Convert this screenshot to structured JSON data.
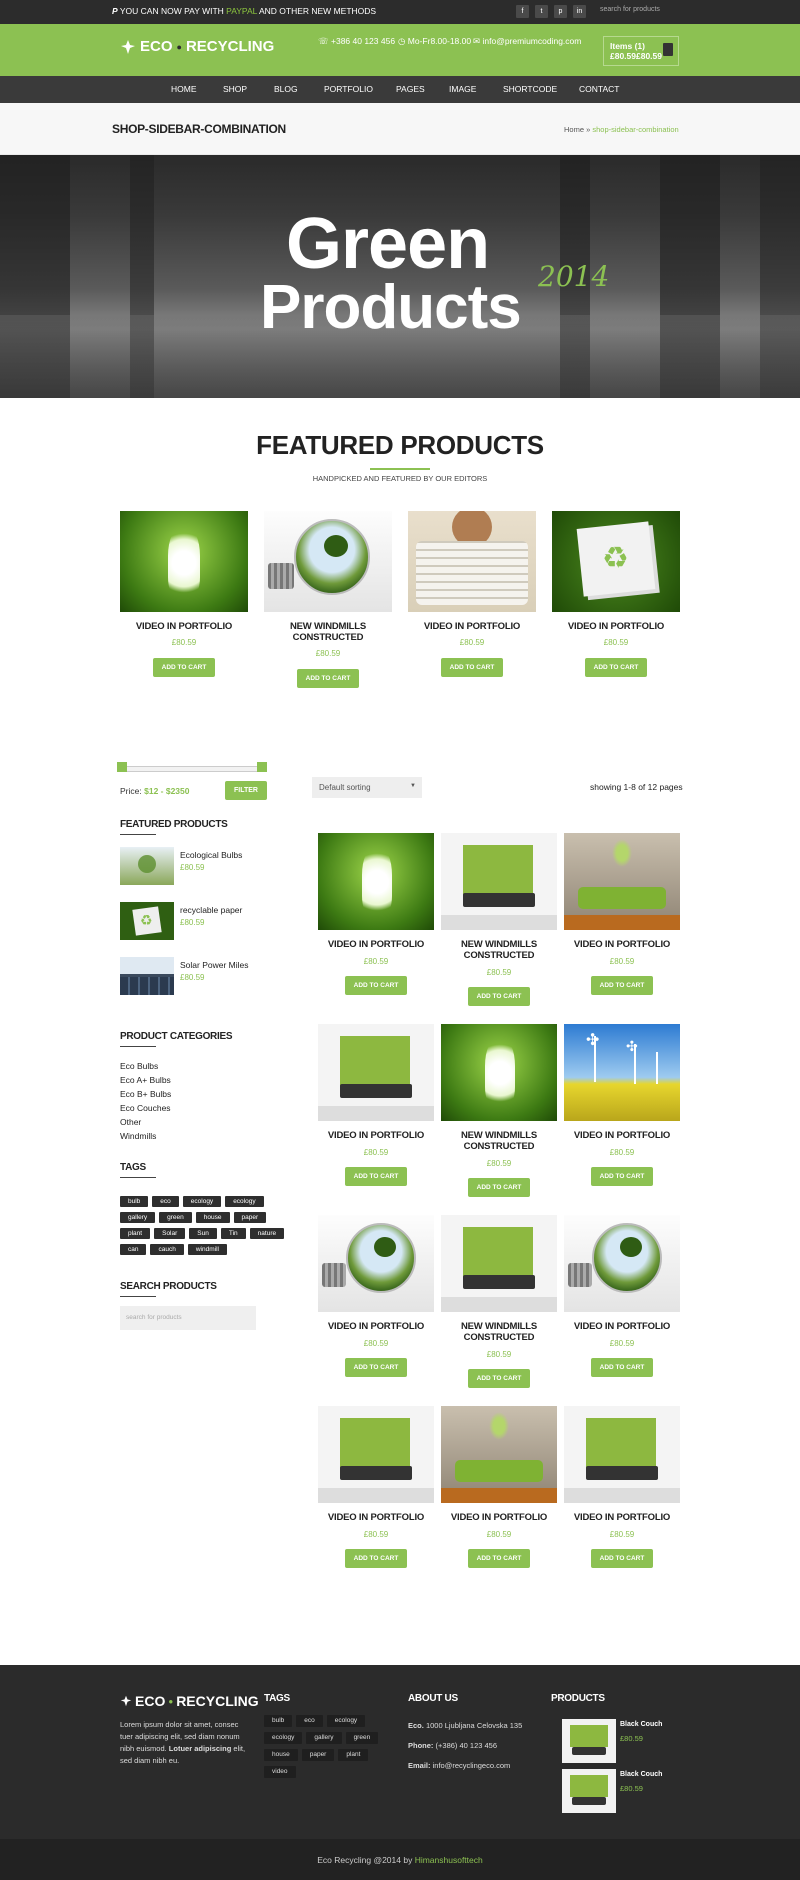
{
  "topbar": {
    "msg_prefix": "YOU CAN NOW PAY WITH",
    "msg_highlight": "PAYPAL",
    "msg_suffix": "AND OTHER NEW METHODS",
    "social": [
      "f",
      "t",
      "p",
      "in"
    ],
    "search_placeholder": "search for products"
  },
  "header": {
    "logo_a": "ECO",
    "logo_b": "RECYCLING",
    "phone": "+386 40 123 456",
    "hours": "Mo-Fr8.00-18.00",
    "email": "info@premiumcoding.com",
    "cart_items": "Items (1)",
    "cart_total": "£80.59£80.59"
  },
  "nav": [
    "HOME",
    "SHOP",
    "BLOG",
    "PORTFOLIO",
    "PAGES",
    "IMAGE",
    "SHORTCODE",
    "CONTACT"
  ],
  "breadcrumb": {
    "title": "SHOP-SIDEBAR-COMBINATION",
    "home": "Home",
    "sep": "»",
    "current": "shop-sidebar-combination"
  },
  "hero": {
    "line1": "Green",
    "line2": "Products",
    "year": "2014"
  },
  "featured": {
    "title": "FEATURED PRODUCTS",
    "subtitle": "HANDPICKED AND FEATURED BY OUR EDITORS",
    "items": [
      {
        "title": "VIDEO IN PORTFOLIO",
        "price": "£80.59",
        "button": "ADD TO CART"
      },
      {
        "title": "NEW WINDMILLS CONSTRUCTED",
        "price": "£80.59",
        "button": "ADD TO CART"
      },
      {
        "title": "VIDEO IN PORTFOLIO",
        "price": "£80.59",
        "button": "ADD TO CART"
      },
      {
        "title": "VIDEO IN PORTFOLIO",
        "price": "£80.59",
        "button": "ADD TO CART"
      }
    ]
  },
  "sidebar": {
    "price_label": "Price:",
    "price_range": "$12 - $2350",
    "filter": "FILTER",
    "featured_heading": "FEATURED PRODUCTS",
    "featured": [
      {
        "name": "Ecological Bulbs",
        "price": "£80.59"
      },
      {
        "name": "recyclable paper",
        "price": "£80.59"
      },
      {
        "name": "Solar Power Miles",
        "price": "£80.59"
      }
    ],
    "categories_heading": "PRODUCT CATEGORIES",
    "categories": [
      "Eco Bulbs",
      "Eco A+ Bulbs",
      "Eco B+ Bulbs",
      "Eco Couches",
      "Other",
      "Windmills"
    ],
    "tags_heading": "TAGS",
    "tags": [
      [
        "bulb",
        "eco",
        "ecology",
        "ecology"
      ],
      [
        "gallery",
        "green",
        "house",
        "paper"
      ],
      [
        "plant",
        "Solar",
        "Sun",
        "Tin",
        "nature"
      ],
      [
        "can",
        "cauch",
        "windmill"
      ]
    ],
    "search_heading": "SEARCH PRODUCTS",
    "search_placeholder": "search for products"
  },
  "shop": {
    "sort": "Default sorting",
    "showing": "showing 1-8 of 12 pages",
    "products": [
      {
        "title": "VIDEO IN PORTFOLIO",
        "price": "£80.59",
        "button": "ADD TO CART"
      },
      {
        "title": "NEW WINDMILLS CONSTRUCTED",
        "price": "£80.59",
        "button": "ADD TO CART"
      },
      {
        "title": "VIDEO IN PORTFOLIO",
        "price": "£80.59",
        "button": "ADD TO CART"
      },
      {
        "title": "VIDEO IN PORTFOLIO",
        "price": "£80.59",
        "button": "ADD TO CART"
      },
      {
        "title": "NEW WINDMILLS CONSTRUCTED",
        "price": "£80.59",
        "button": "ADD TO CART"
      },
      {
        "title": "VIDEO IN PORTFOLIO",
        "price": "£80.59",
        "button": "ADD TO CART"
      },
      {
        "title": "VIDEO IN PORTFOLIO",
        "price": "£80.59",
        "button": "ADD TO CART"
      },
      {
        "title": "NEW WINDMILLS CONSTRUCTED",
        "price": "£80.59",
        "button": "ADD TO CART"
      },
      {
        "title": "VIDEO IN PORTFOLIO",
        "price": "£80.59",
        "button": "ADD TO CART"
      },
      {
        "title": "VIDEO IN PORTFOLIO",
        "price": "£80.59",
        "button": "ADD TO CART"
      },
      {
        "title": "VIDEO IN PORTFOLIO",
        "price": "£80.59",
        "button": "ADD TO CART"
      },
      {
        "title": "VIDEO IN PORTFOLIO",
        "price": "£80.59",
        "button": "ADD TO CART"
      }
    ]
  },
  "footer": {
    "logo_a": "ECO",
    "logo_b": "RECYCLING",
    "about_p1": "Lorem ipsum dolor sit amet, consec tuer adipiscing elit, sed diam nonum nibh euismod.",
    "about_bold": "Lotuer adipiscing",
    "about_p2": "elit, sed diam nibh eu.",
    "tags_heading": "TAGS",
    "tags": [
      [
        "bulb",
        "eco",
        "ecology"
      ],
      [
        "ecology",
        "gallery",
        "green"
      ],
      [
        "house",
        "paper",
        "plant"
      ],
      [
        "video"
      ]
    ],
    "about_heading": "ABOUT US",
    "addr_label": "Eco.",
    "addr": "1000 Ljubljana Celovska 135",
    "phone_label": "Phone:",
    "phone": "(+386) 40 123 456",
    "email_label": "Email:",
    "email": "info@recyclingeco.com",
    "products_heading": "PRODUCTS",
    "products": [
      {
        "name": "Black Couch",
        "price": "£80.59"
      },
      {
        "name": "Black Couch",
        "price": "£80.59"
      }
    ],
    "copyright": "Eco Recycling @2014 by",
    "author": "Himanshusofttech"
  },
  "colors": {
    "accent": "#8cc152",
    "dark": "#2c2c2c",
    "nav": "#3a3a3a",
    "footer": "#2b2b2b"
  }
}
